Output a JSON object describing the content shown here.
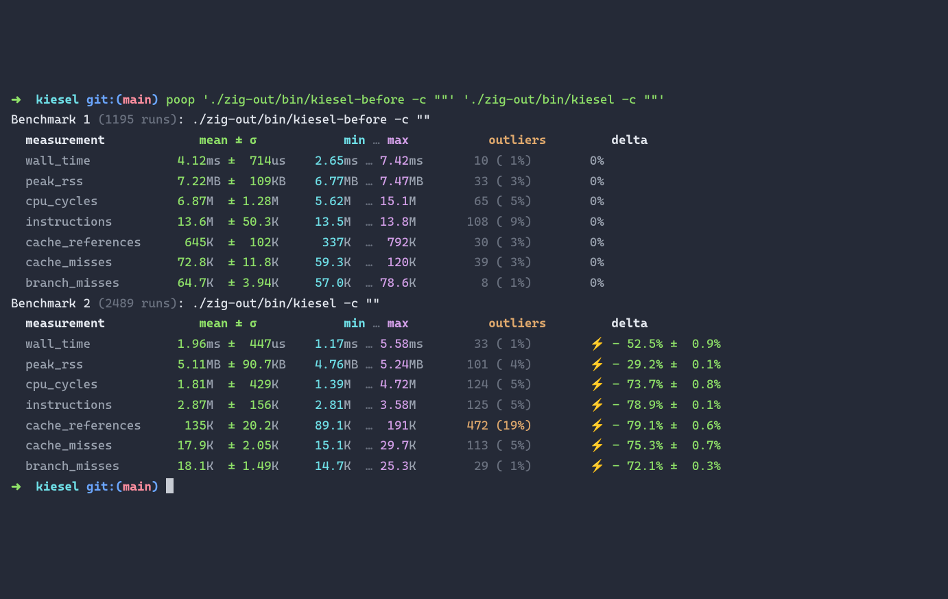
{
  "prompt": {
    "arrow": "➜",
    "dir": "kiesel",
    "git_label": "git:(",
    "branch": "main",
    "git_close": ")",
    "command": "poop './zig-out/bin/kiesel-before -c \"\"' './zig-out/bin/kiesel -c \"\"'"
  },
  "bench1": {
    "title_a": "Benchmark 1",
    "runs": "(1195 runs)",
    "title_b": ": ./zig-out/bin/kiesel-before -c \"\""
  },
  "bench2": {
    "title_a": "Benchmark 2",
    "runs": "(2489 runs)",
    "title_b": ": ./zig-out/bin/kiesel -c \"\""
  },
  "headers": {
    "measurement": "measurement",
    "mean": "mean",
    "pm": "±",
    "sigma": "σ",
    "min": "min",
    "ell": "…",
    "max": "max",
    "outliers": "outliers",
    "delta": "delta"
  },
  "rows1": [
    {
      "name": "wall_time",
      "mean": "4.12",
      "mu": "ms",
      "sig": " 714",
      "su": "us",
      "min": "2.65",
      "minu": "ms",
      "max": "7.42",
      "maxu": "ms",
      "outn": " 10",
      "outp": "( 1%)",
      "outhi": false,
      "delta": "0%"
    },
    {
      "name": "peak_rss",
      "mean": "7.22",
      "mu": "MB",
      "sig": " 109",
      "su": "KB",
      "min": "6.77",
      "minu": "MB",
      "max": "7.47",
      "maxu": "MB",
      "outn": " 33",
      "outp": "( 3%)",
      "outhi": false,
      "delta": "0%"
    },
    {
      "name": "cpu_cycles",
      "mean": "6.87",
      "mu": "M ",
      "sig": "1.28",
      "su": "M ",
      "min": "5.62",
      "minu": "M ",
      "max": "15.1",
      "maxu": "M ",
      "outn": " 65",
      "outp": "( 5%)",
      "outhi": false,
      "delta": "0%"
    },
    {
      "name": "instructions",
      "mean": "13.6",
      "mu": "M ",
      "sig": "50.3",
      "su": "K ",
      "min": "13.5",
      "minu": "M ",
      "max": "13.8",
      "maxu": "M ",
      "outn": "108",
      "outp": "( 9%)",
      "outhi": false,
      "delta": "0%"
    },
    {
      "name": "cache_references",
      "mean": " 645",
      "mu": "K ",
      "sig": " 102",
      "su": "K ",
      "min": " 337",
      "minu": "K ",
      "max": " 792",
      "maxu": "K ",
      "outn": " 30",
      "outp": "( 3%)",
      "outhi": false,
      "delta": "0%"
    },
    {
      "name": "cache_misses",
      "mean": "72.8",
      "mu": "K ",
      "sig": "11.8",
      "su": "K ",
      "min": "59.3",
      "minu": "K ",
      "max": " 120",
      "maxu": "K ",
      "outn": " 39",
      "outp": "( 3%)",
      "outhi": false,
      "delta": "0%"
    },
    {
      "name": "branch_misses",
      "mean": "64.7",
      "mu": "K ",
      "sig": "3.94",
      "su": "K ",
      "min": "57.0",
      "minu": "K ",
      "max": "78.6",
      "maxu": "K ",
      "outn": "  8",
      "outp": "( 1%)",
      "outhi": false,
      "delta": "0%"
    }
  ],
  "rows2": [
    {
      "name": "wall_time",
      "mean": "1.96",
      "mu": "ms",
      "sig": " 447",
      "su": "us",
      "min": "1.17",
      "minu": "ms",
      "max": "5.58",
      "maxu": "ms",
      "outn": " 33",
      "outp": "( 1%)",
      "outhi": false,
      "delta": "- 52.5%",
      "derr": "0.9%"
    },
    {
      "name": "peak_rss",
      "mean": "5.11",
      "mu": "MB",
      "sig": "90.7",
      "su": "KB",
      "min": "4.76",
      "minu": "MB",
      "max": "5.24",
      "maxu": "MB",
      "outn": "101",
      "outp": "( 4%)",
      "outhi": false,
      "delta": "- 29.2%",
      "derr": "0.1%"
    },
    {
      "name": "cpu_cycles",
      "mean": "1.81",
      "mu": "M ",
      "sig": " 429",
      "su": "K ",
      "min": "1.39",
      "minu": "M ",
      "max": "4.72",
      "maxu": "M ",
      "outn": "124",
      "outp": "( 5%)",
      "outhi": false,
      "delta": "- 73.7%",
      "derr": "0.8%"
    },
    {
      "name": "instructions",
      "mean": "2.87",
      "mu": "M ",
      "sig": " 156",
      "su": "K ",
      "min": "2.81",
      "minu": "M ",
      "max": "3.58",
      "maxu": "M ",
      "outn": "125",
      "outp": "( 5%)",
      "outhi": false,
      "delta": "- 78.9%",
      "derr": "0.1%"
    },
    {
      "name": "cache_references",
      "mean": " 135",
      "mu": "K ",
      "sig": "20.2",
      "su": "K ",
      "min": "89.1",
      "minu": "K ",
      "max": " 191",
      "maxu": "K ",
      "outn": "472",
      "outp": "(19%)",
      "outhi": true,
      "delta": "- 79.1%",
      "derr": "0.6%"
    },
    {
      "name": "cache_misses",
      "mean": "17.9",
      "mu": "K ",
      "sig": "2.05",
      "su": "K ",
      "min": "15.1",
      "minu": "K ",
      "max": "29.7",
      "maxu": "K ",
      "outn": "113",
      "outp": "( 5%)",
      "outhi": false,
      "delta": "- 75.3%",
      "derr": "0.7%"
    },
    {
      "name": "branch_misses",
      "mean": "18.1",
      "mu": "K ",
      "sig": "1.49",
      "su": "K ",
      "min": "14.7",
      "minu": "K ",
      "max": "25.3",
      "maxu": "K ",
      "outn": " 29",
      "outp": "( 1%)",
      "outhi": false,
      "delta": "- 72.1%",
      "derr": "0.3%"
    }
  ],
  "chart_data": {
    "type": "table",
    "title": "poop benchmark comparison",
    "series": [
      {
        "name": "./zig-out/bin/kiesel-before -c \"\"",
        "runs": 1195,
        "metrics": {
          "wall_time": {
            "mean": "4.12ms",
            "sigma": "714us",
            "min": "2.65ms",
            "max": "7.42ms",
            "outliers": 10,
            "outlier_pct": 1
          },
          "peak_rss": {
            "mean": "7.22MB",
            "sigma": "109KB",
            "min": "6.77MB",
            "max": "7.47MB",
            "outliers": 33,
            "outlier_pct": 3
          },
          "cpu_cycles": {
            "mean": "6.87M",
            "sigma": "1.28M",
            "min": "5.62M",
            "max": "15.1M",
            "outliers": 65,
            "outlier_pct": 5
          },
          "instructions": {
            "mean": "13.6M",
            "sigma": "50.3K",
            "min": "13.5M",
            "max": "13.8M",
            "outliers": 108,
            "outlier_pct": 9
          },
          "cache_references": {
            "mean": "645K",
            "sigma": "102K",
            "min": "337K",
            "max": "792K",
            "outliers": 30,
            "outlier_pct": 3
          },
          "cache_misses": {
            "mean": "72.8K",
            "sigma": "11.8K",
            "min": "59.3K",
            "max": "120K",
            "outliers": 39,
            "outlier_pct": 3
          },
          "branch_misses": {
            "mean": "64.7K",
            "sigma": "3.94K",
            "min": "57.0K",
            "max": "78.6K",
            "outliers": 8,
            "outlier_pct": 1
          }
        }
      },
      {
        "name": "./zig-out/bin/kiesel -c \"\"",
        "runs": 2489,
        "metrics": {
          "wall_time": {
            "mean": "1.96ms",
            "sigma": "447us",
            "min": "1.17ms",
            "max": "5.58ms",
            "outliers": 33,
            "outlier_pct": 1,
            "delta": -52.5,
            "derr": 0.9
          },
          "peak_rss": {
            "mean": "5.11MB",
            "sigma": "90.7KB",
            "min": "4.76MB",
            "max": "5.24MB",
            "outliers": 101,
            "outlier_pct": 4,
            "delta": -29.2,
            "derr": 0.1
          },
          "cpu_cycles": {
            "mean": "1.81M",
            "sigma": "429K",
            "min": "1.39M",
            "max": "4.72M",
            "outliers": 124,
            "outlier_pct": 5,
            "delta": -73.7,
            "derr": 0.8
          },
          "instructions": {
            "mean": "2.87M",
            "sigma": "156K",
            "min": "2.81M",
            "max": "3.58M",
            "outliers": 125,
            "outlier_pct": 5,
            "delta": -78.9,
            "derr": 0.1
          },
          "cache_references": {
            "mean": "135K",
            "sigma": "20.2K",
            "min": "89.1K",
            "max": "191K",
            "outliers": 472,
            "outlier_pct": 19,
            "delta": -79.1,
            "derr": 0.6
          },
          "cache_misses": {
            "mean": "17.9K",
            "sigma": "2.05K",
            "min": "15.1K",
            "max": "29.7K",
            "outliers": 113,
            "outlier_pct": 5,
            "delta": -75.3,
            "derr": 0.7
          },
          "branch_misses": {
            "mean": "18.1K",
            "sigma": "1.49K",
            "min": "14.7K",
            "max": "25.3K",
            "outliers": 29,
            "outlier_pct": 1,
            "delta": -72.1,
            "derr": 0.3
          }
        }
      }
    ]
  }
}
